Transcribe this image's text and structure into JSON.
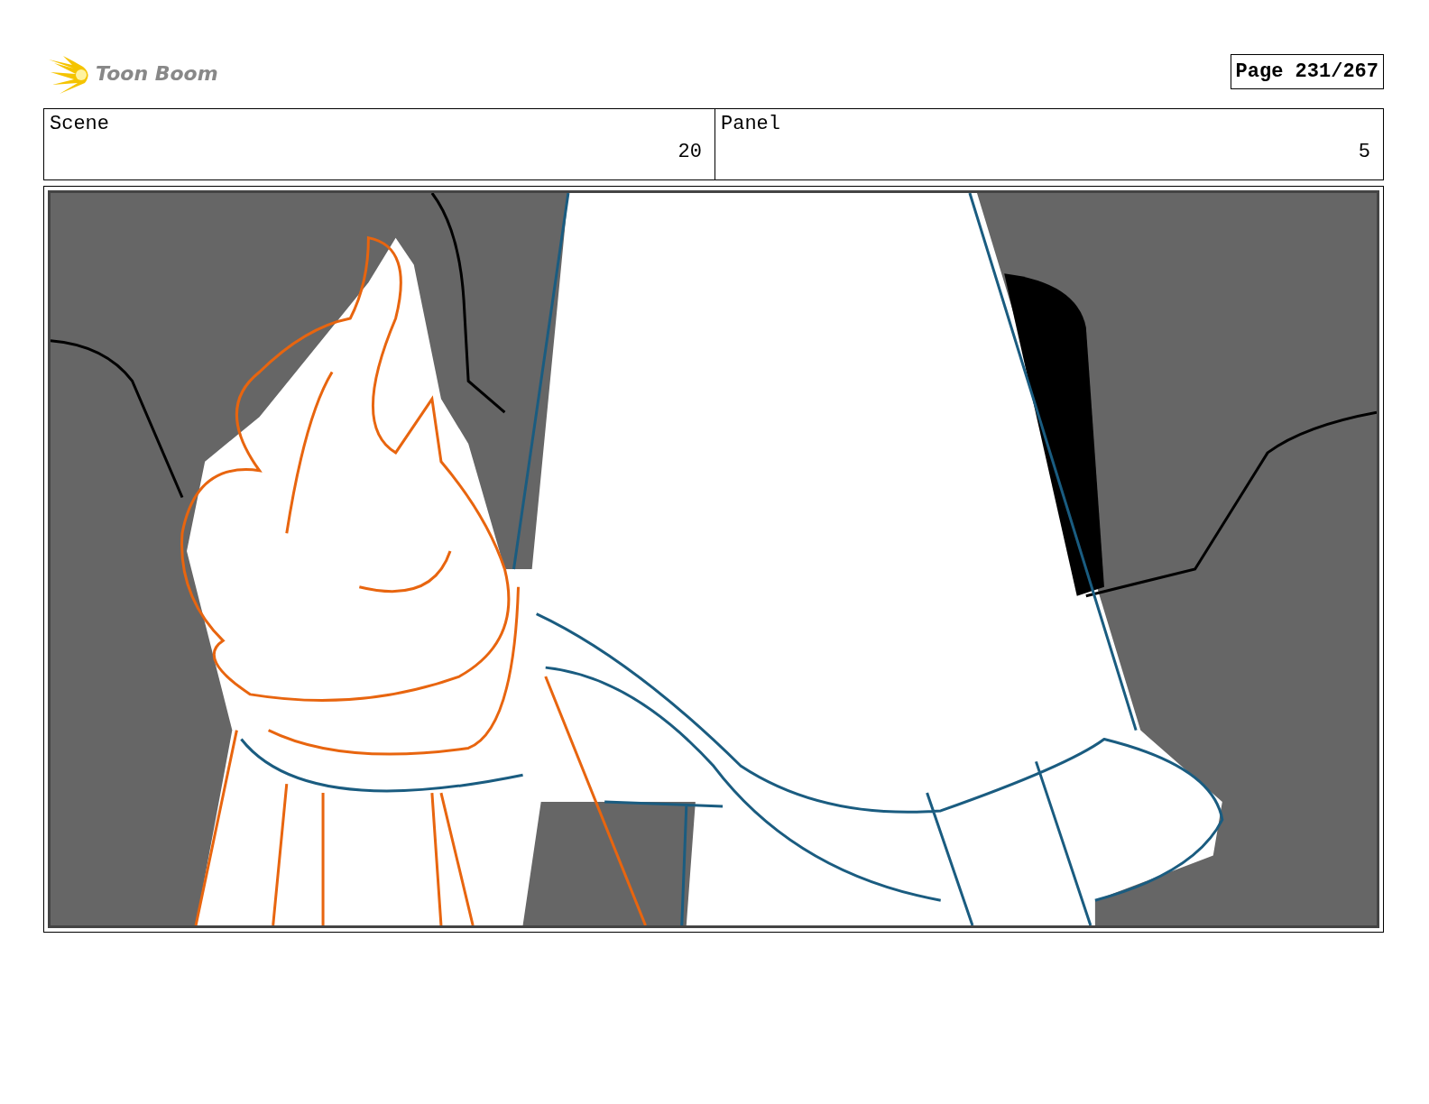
{
  "header": {
    "logo_text": "Toon Boom",
    "page": "Page 231/267"
  },
  "info": [
    {
      "label": "Scene",
      "value": "20"
    },
    {
      "label": "Panel",
      "value": "5"
    }
  ]
}
